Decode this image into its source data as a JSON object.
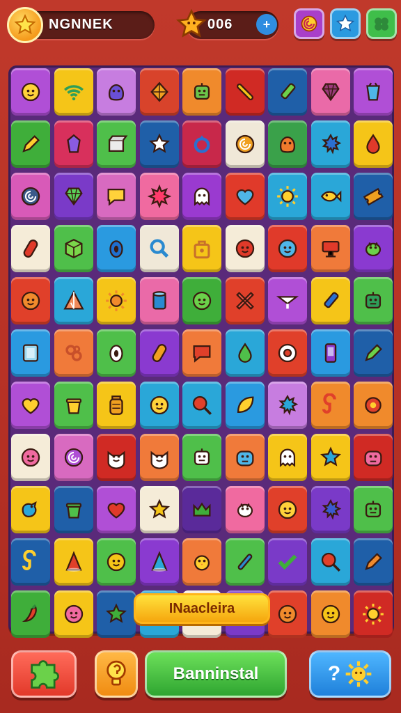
{
  "header": {
    "player_name": "NGNNEK",
    "score_text": "006",
    "plus_symbol": "+"
  },
  "board": {
    "banner_text": "INaacleira",
    "tiles": [
      [
        "#b04fd6",
        "smiley",
        "#ffd23a"
      ],
      [
        "#f5c518",
        "wifi",
        "#2e9e58"
      ],
      [
        "#c77de0",
        "blob",
        "#6a4fd6"
      ],
      [
        "#d8432b",
        "kite",
        "#f0a020"
      ],
      [
        "#f08a2c",
        "robot",
        "#6bc44a"
      ],
      [
        "#d02a24",
        "stick",
        "#f5c518"
      ],
      [
        "#1f5fa8",
        "pen",
        "#6bd14a"
      ],
      [
        "#ea6aa8",
        "gem",
        "#9a3a7a"
      ],
      [
        "#b04fd6",
        "cup",
        "#4fb6e8"
      ],
      [
        "#3fae3a",
        "pencil",
        "#ffcf2e"
      ],
      [
        "#d8305c",
        "crystal",
        "#8a5be0"
      ],
      [
        "#4fbf4a",
        "box",
        "#ececec"
      ],
      [
        "#1f5fa8",
        "star",
        "#ffffff"
      ],
      [
        "#c8284a",
        "ring",
        "#2a6fd0"
      ],
      [
        "#f0e8d8",
        "swirl",
        "#f0a020"
      ],
      [
        "#3aa14a",
        "blob",
        "#f07a2c"
      ],
      [
        "#2aa7d8",
        "splat",
        "#2b6fd0"
      ],
      [
        "#f5c518",
        "drop",
        "#e03a2a"
      ],
      [
        "#d85ab8",
        "swirl",
        "#3a5a8a"
      ],
      [
        "#7a3ac8",
        "gem",
        "#5ad05a"
      ],
      [
        "#d86ac0",
        "speech",
        "#ffd23a"
      ],
      [
        "#f06aa0",
        "burst",
        "#ff3a6a"
      ],
      [
        "#9a3ad0",
        "ghost",
        "#ffffff"
      ],
      [
        "#e03a2a",
        "heart",
        "#4fb6e8"
      ],
      [
        "#2aa7d8",
        "sun",
        "#ffcf2e"
      ],
      [
        "#2aa7d8",
        "fish",
        "#ffcf2e"
      ],
      [
        "#1f5fa8",
        "ticket",
        "#f0a020"
      ],
      [
        "#f5ecd8",
        "capsule",
        "#e03a2a"
      ],
      [
        "#4fbf4a",
        "cube",
        "#7ad64a"
      ],
      [
        "#2a9ae0",
        "egg",
        "#1f6fd0"
      ],
      [
        "#f0e8d8",
        "search",
        "#2a8ad0"
      ],
      [
        "#f5c518",
        "bag",
        "#c8702a"
      ],
      [
        "#f5ecd8",
        "smiley",
        "#e03a2a"
      ],
      [
        "#e03a2a",
        "smiley",
        "#4fb6e8"
      ],
      [
        "#f07a3a",
        "monitor",
        "#e03a2a"
      ],
      [
        "#8a3ad0",
        "bug",
        "#6bd14a"
      ],
      [
        "#e0402a",
        "smiley",
        "#f08a2c"
      ],
      [
        "#2aa7d8",
        "tent",
        "#f08a5a"
      ],
      [
        "#f5c518",
        "sun",
        "#f08a2c"
      ],
      [
        "#ea6aa8",
        "can",
        "#2a8ad0"
      ],
      [
        "#3fae3a",
        "smiley",
        "#6bd14a"
      ],
      [
        "#e0402a",
        "cross",
        "#ff5a4a"
      ],
      [
        "#b04fd6",
        "arrow",
        "#ffffff"
      ],
      [
        "#f5c518",
        "pen",
        "#2a6fd0"
      ],
      [
        "#4fbf4a",
        "robot",
        "#2e9e58"
      ],
      [
        "#2a9ae0",
        "frame",
        "#9ad8f0"
      ],
      [
        "#f07a3a",
        "knot",
        "#c8502a"
      ],
      [
        "#4fbf4a",
        "egg",
        "#ffffff"
      ],
      [
        "#8a3ad0",
        "capsule",
        "#f0a020"
      ],
      [
        "#f07a3a",
        "speech",
        "#e0402a"
      ],
      [
        "#2aa7d8",
        "drop",
        "#4fbf4a"
      ],
      [
        "#e0402a",
        "donut",
        "#ffffff"
      ],
      [
        "#2a9ae0",
        "phone",
        "#8a3ad0"
      ],
      [
        "#1f5fa8",
        "pencil",
        "#6bd14a"
      ],
      [
        "#b04fd6",
        "heart",
        "#ffcf2e"
      ],
      [
        "#4fbf4a",
        "pot",
        "#ffcf2e"
      ],
      [
        "#f5c518",
        "jar",
        "#f0a020"
      ],
      [
        "#2aa7d8",
        "smiley",
        "#ffd23a"
      ],
      [
        "#2aa7d8",
        "pan",
        "#e0402a"
      ],
      [
        "#2a9ae0",
        "leaf",
        "#ffcf2e"
      ],
      [
        "#c77de0",
        "splat",
        "#2aa7d8"
      ],
      [
        "#f08a2c",
        "hook",
        "#e0402a"
      ],
      [
        "#f08a2c",
        "flower",
        "#e0402a"
      ],
      [
        "#f5ecd8",
        "smiley",
        "#f06aa0"
      ],
      [
        "#d86ac0",
        "swirl",
        "#b04fd6"
      ],
      [
        "#d02a24",
        "cat",
        "#ffffff"
      ],
      [
        "#f07a3a",
        "cat",
        "#ffffff"
      ],
      [
        "#4fbf4a",
        "robot",
        "#ffffff"
      ],
      [
        "#f07a3a",
        "monster",
        "#4fb6e8"
      ],
      [
        "#f5c518",
        "ghost",
        "#ffffff"
      ],
      [
        "#f5c518",
        "star",
        "#2aa7d8"
      ],
      [
        "#d02a24",
        "monster",
        "#f06aa0"
      ],
      [
        "#f5c518",
        "bird",
        "#2aa7d8"
      ],
      [
        "#1f5fa8",
        "pot",
        "#4fbf4a"
      ],
      [
        "#b04fd6",
        "heart",
        "#e03a2a"
      ],
      [
        "#f5ecd8",
        "star",
        "#f5c518"
      ],
      [
        "#5a2a9a",
        "crown",
        "#3fae3a"
      ],
      [
        "#f06aa0",
        "bug",
        "#ffffff"
      ],
      [
        "#e0402a",
        "smiley",
        "#ffd23a"
      ],
      [
        "#7a3ac8",
        "splat",
        "#3a5ad0"
      ],
      [
        "#4fbf4a",
        "robot",
        "#4fbf4a"
      ],
      [
        "#1f5fa8",
        "hook",
        "#ffcf2e"
      ],
      [
        "#f5c518",
        "cone",
        "#e0402a"
      ],
      [
        "#4fbf4a",
        "smiley",
        "#f5c518"
      ],
      [
        "#8a3ad0",
        "cone",
        "#2aa7d8"
      ],
      [
        "#f07a3a",
        "chick",
        "#ffcf2e"
      ],
      [
        "#4fbf4a",
        "pin",
        "#2a8ad0"
      ],
      [
        "#7a3ac8",
        "check",
        "#3fae3a"
      ],
      [
        "#2aa7d8",
        "pan",
        "#e0402a"
      ],
      [
        "#1f5fa8",
        "pencil",
        "#f08a2c"
      ],
      [
        "#3fae3a",
        "chili",
        "#e0402a"
      ],
      [
        "#f5c518",
        "smiley",
        "#f06aa0"
      ],
      [
        "#1f5fa8",
        "star",
        "#3fae3a"
      ],
      [
        "#2aa7d8",
        "blank",
        "#ffffff"
      ],
      [
        "#f5ecd8",
        "blank",
        "#ffffff"
      ],
      [
        "#7a3ac8",
        "blank",
        "#ffffff"
      ],
      [
        "#e0402a",
        "smiley",
        "#f08a2c"
      ],
      [
        "#f08a2c",
        "smiley",
        "#f5c518"
      ],
      [
        "#d02a24",
        "sun",
        "#ffcf2e"
      ]
    ]
  },
  "footer": {
    "go_label": "Banninstal",
    "help_symbol": "?"
  }
}
